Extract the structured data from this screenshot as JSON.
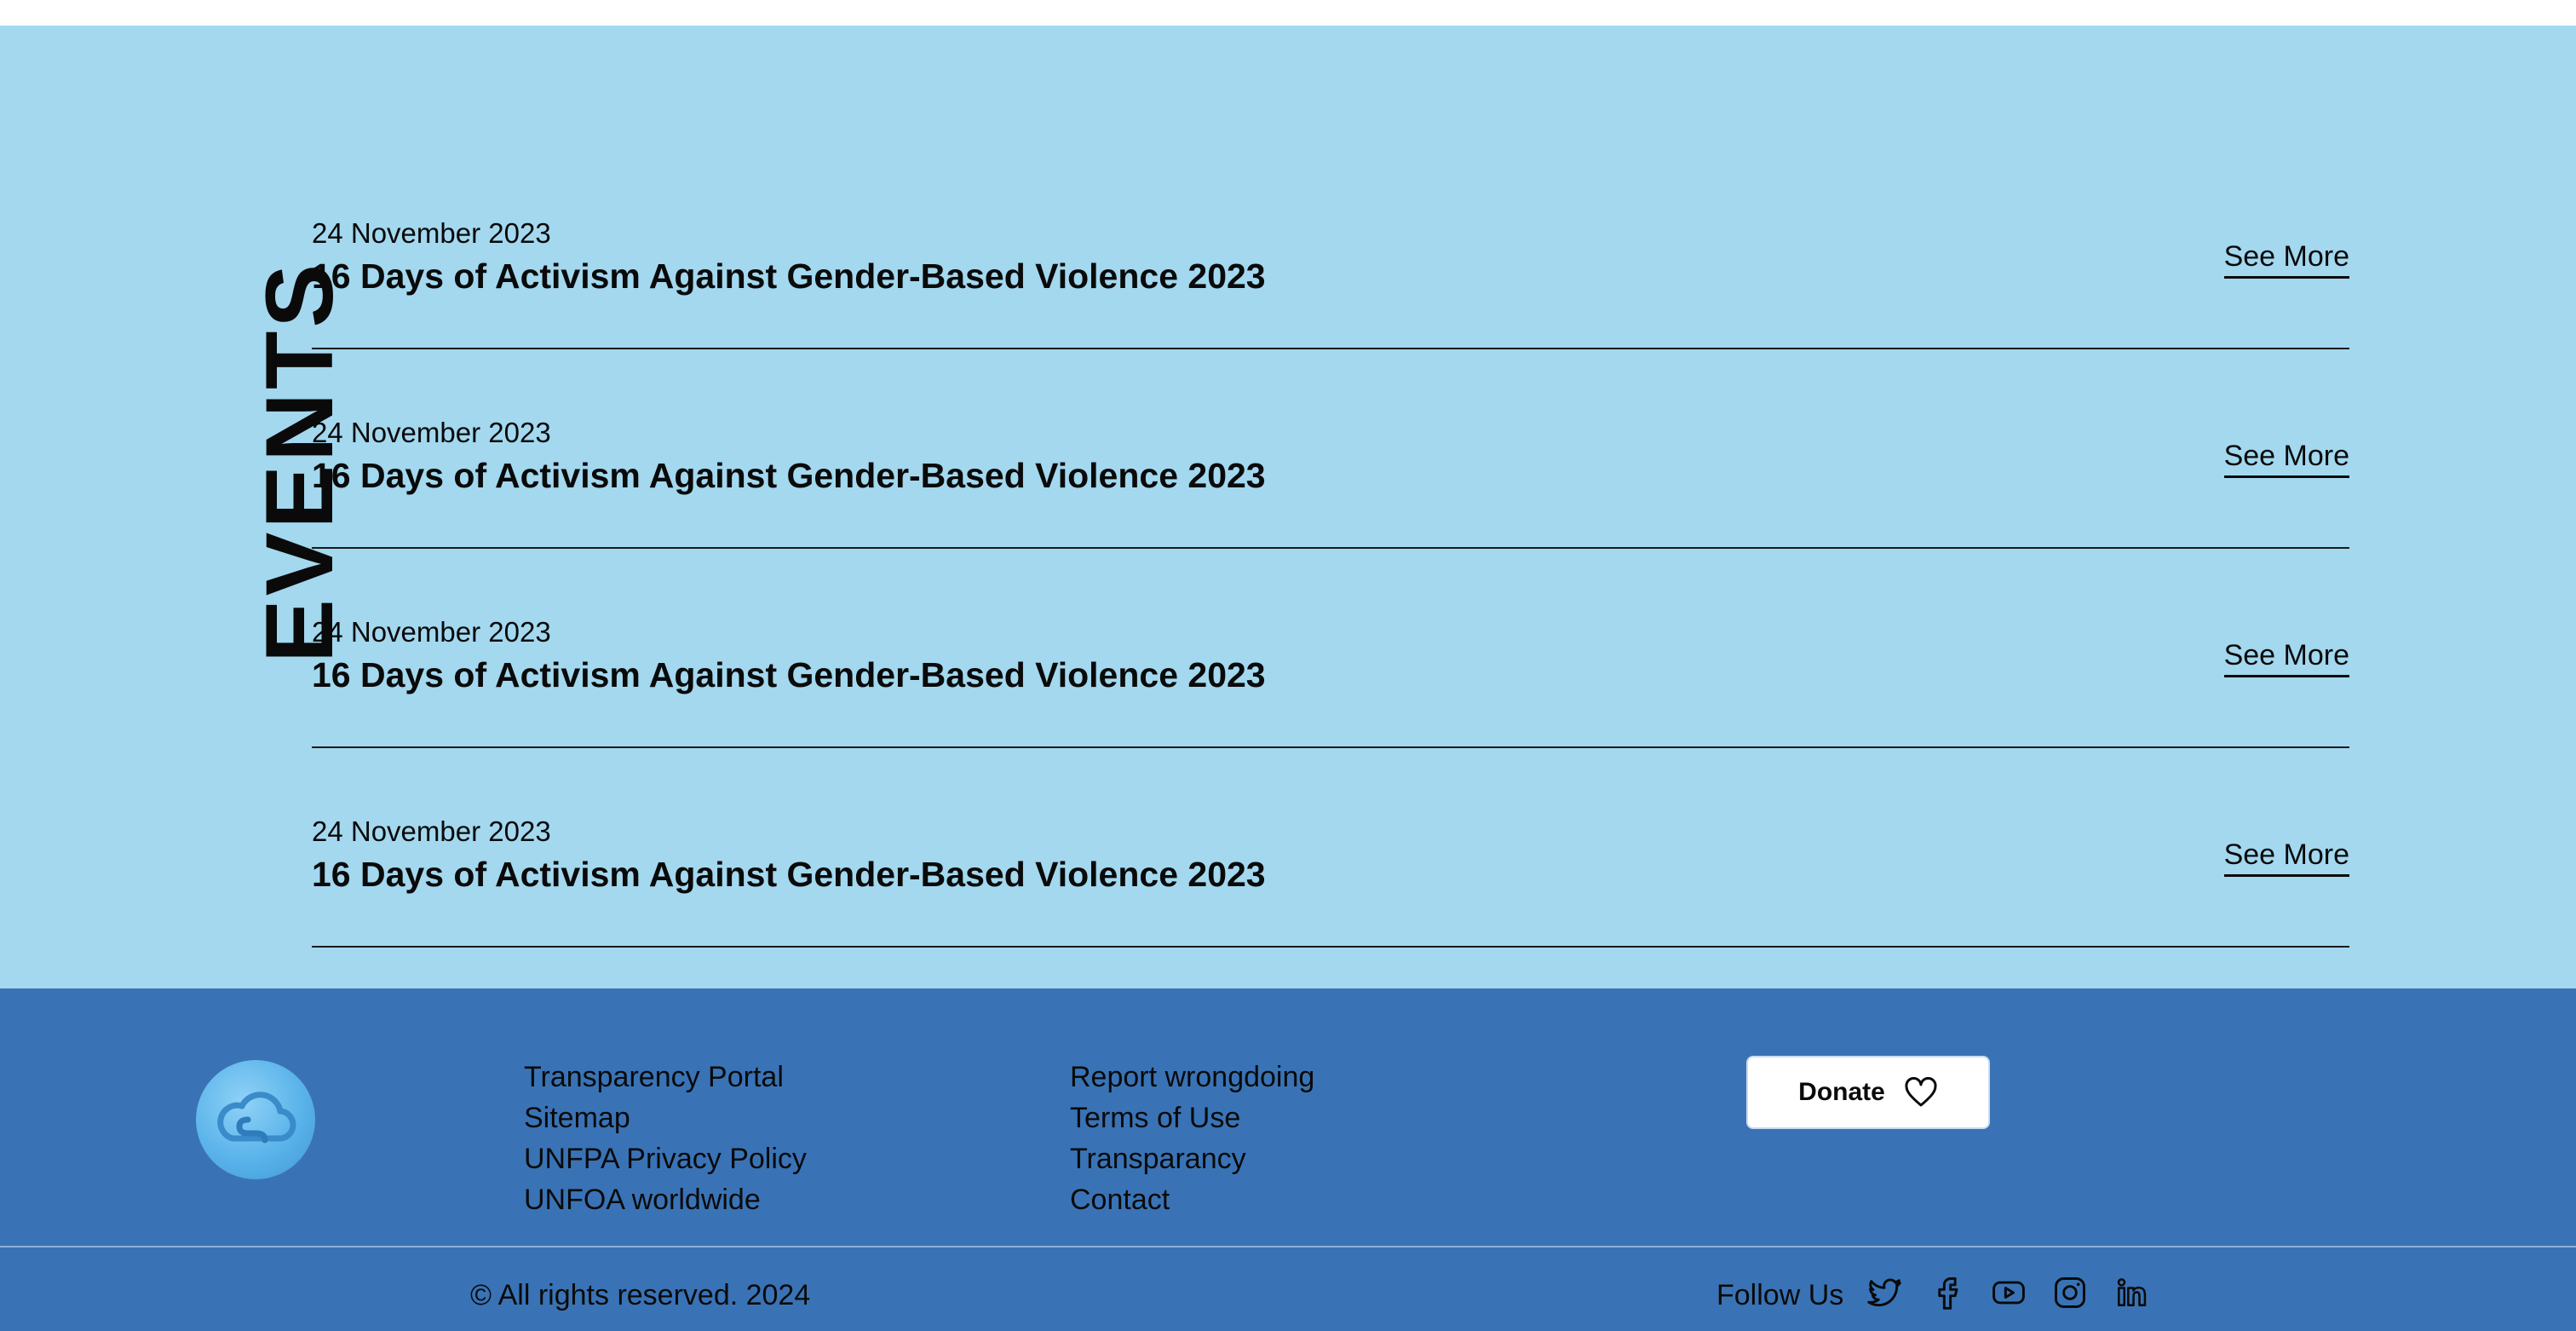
{
  "section": {
    "title": "EVENTS"
  },
  "events": [
    {
      "date": "24 November 2023",
      "title": "16 Days of Activism Against Gender-Based Violence 2023",
      "link_label": "See More"
    },
    {
      "date": "24 November 2023",
      "title": "16 Days of Activism Against Gender-Based Violence 2023",
      "link_label": "See More"
    },
    {
      "date": "24 November 2023",
      "title": "16 Days of Activism Against Gender-Based Violence 2023",
      "link_label": "See More"
    },
    {
      "date": "24 November 2023",
      "title": "16 Days of Activism Against Gender-Based Violence 2023",
      "link_label": "See More"
    }
  ],
  "footer": {
    "logo_icon": "cloud-logo-icon",
    "links_col1": [
      "Transparency Portal",
      "Sitemap",
      "UNFPA Privacy Policy",
      "UNFOA worldwide"
    ],
    "links_col2": [
      "Report wrongdoing",
      "Terms of Use",
      "Transparancy",
      "Contact"
    ],
    "donate_label": "Donate",
    "donate_icon": "heart-icon",
    "copyright": "© All rights reserved. 2024",
    "follow_label": "Follow Us",
    "social_icons": [
      "twitter-icon",
      "facebook-icon",
      "youtube-icon",
      "instagram-icon",
      "linkedin-icon"
    ]
  },
  "colors": {
    "events_bg": "#a3d8ef",
    "footer_bg": "#3973b6",
    "text": "#0a0a0a",
    "donate_bg": "#ffffff"
  }
}
